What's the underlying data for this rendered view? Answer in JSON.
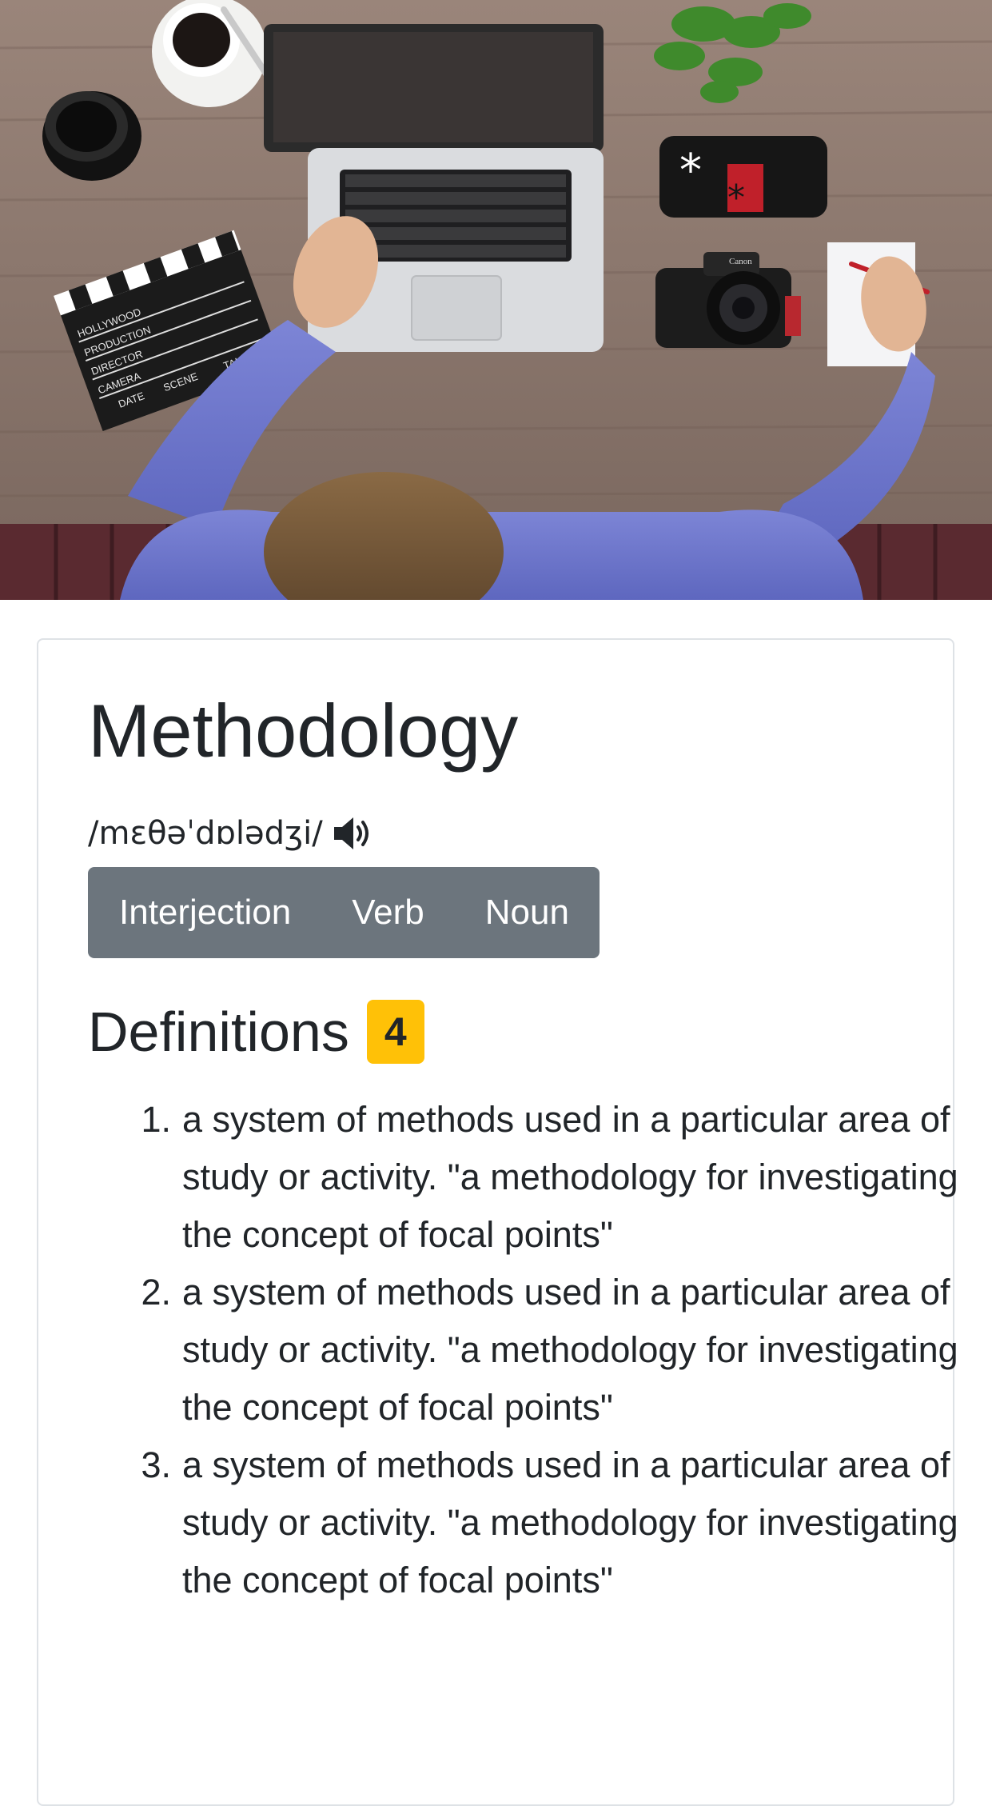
{
  "hero": {
    "alt": "Person working at a wooden desk with laptop, coffee, camera, clapperboard and plant",
    "clapper_lines": [
      "HOLLYWOOD",
      "PRODUCTION",
      "DIRECTOR",
      "CAMERA",
      "DATE",
      "SCENE",
      "TAKE"
    ],
    "camera_brand": "Canon"
  },
  "word": {
    "title": "Methodology",
    "phonetic": "/mɛθəˈdɒlədʒi/",
    "audio_icon": "speaker-icon"
  },
  "parts_of_speech": [
    "Interjection",
    "Verb",
    "Noun"
  ],
  "definitions": {
    "heading": "Definitions",
    "count": "4",
    "items": [
      {
        "number": "1.",
        "text": "a system of methods used in a particular area of study or activity. \"a methodology for investigating the concept of focal points\""
      },
      {
        "number": "2.",
        "text": "a system of methods used in a particular area of study or activity. \"a methodology for investigating the concept of focal points\""
      },
      {
        "number": "3.",
        "text": "a system of methods used in a particular area of study or activity. \"a methodology for investigating the concept of focal points\""
      }
    ]
  },
  "colors": {
    "pos_bg": "#6c757d",
    "badge_bg": "#ffc107",
    "text": "#212529"
  }
}
